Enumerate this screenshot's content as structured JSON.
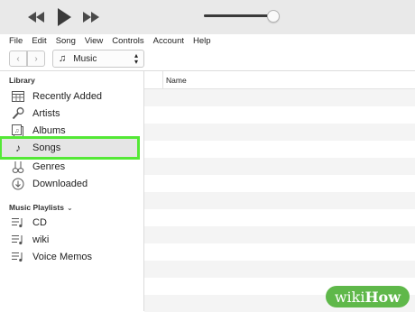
{
  "menu": [
    "File",
    "Edit",
    "Song",
    "View",
    "Controls",
    "Account",
    "Help"
  ],
  "source": {
    "label": "Music"
  },
  "sidebar": {
    "library_heading": "Library",
    "library": [
      {
        "label": "Recently Added",
        "icon": "recently-added-icon"
      },
      {
        "label": "Artists",
        "icon": "microphone-icon"
      },
      {
        "label": "Albums",
        "icon": "album-icon"
      },
      {
        "label": "Songs",
        "icon": "music-note-icon",
        "selected": true
      },
      {
        "label": "Genres",
        "icon": "guitars-icon"
      },
      {
        "label": "Downloaded",
        "icon": "download-icon"
      }
    ],
    "playlists_heading": "Music Playlists",
    "playlists": [
      {
        "label": "CD",
        "icon": "playlist-icon"
      },
      {
        "label": "wiki",
        "icon": "playlist-icon"
      },
      {
        "label": "Voice Memos",
        "icon": "playlist-icon"
      }
    ]
  },
  "main": {
    "column_name": "Name"
  },
  "volume": {
    "level": 1.0
  },
  "colors": {
    "highlight": "#54e836",
    "watermark": "#5fb84a"
  },
  "watermark": "wikiHow"
}
